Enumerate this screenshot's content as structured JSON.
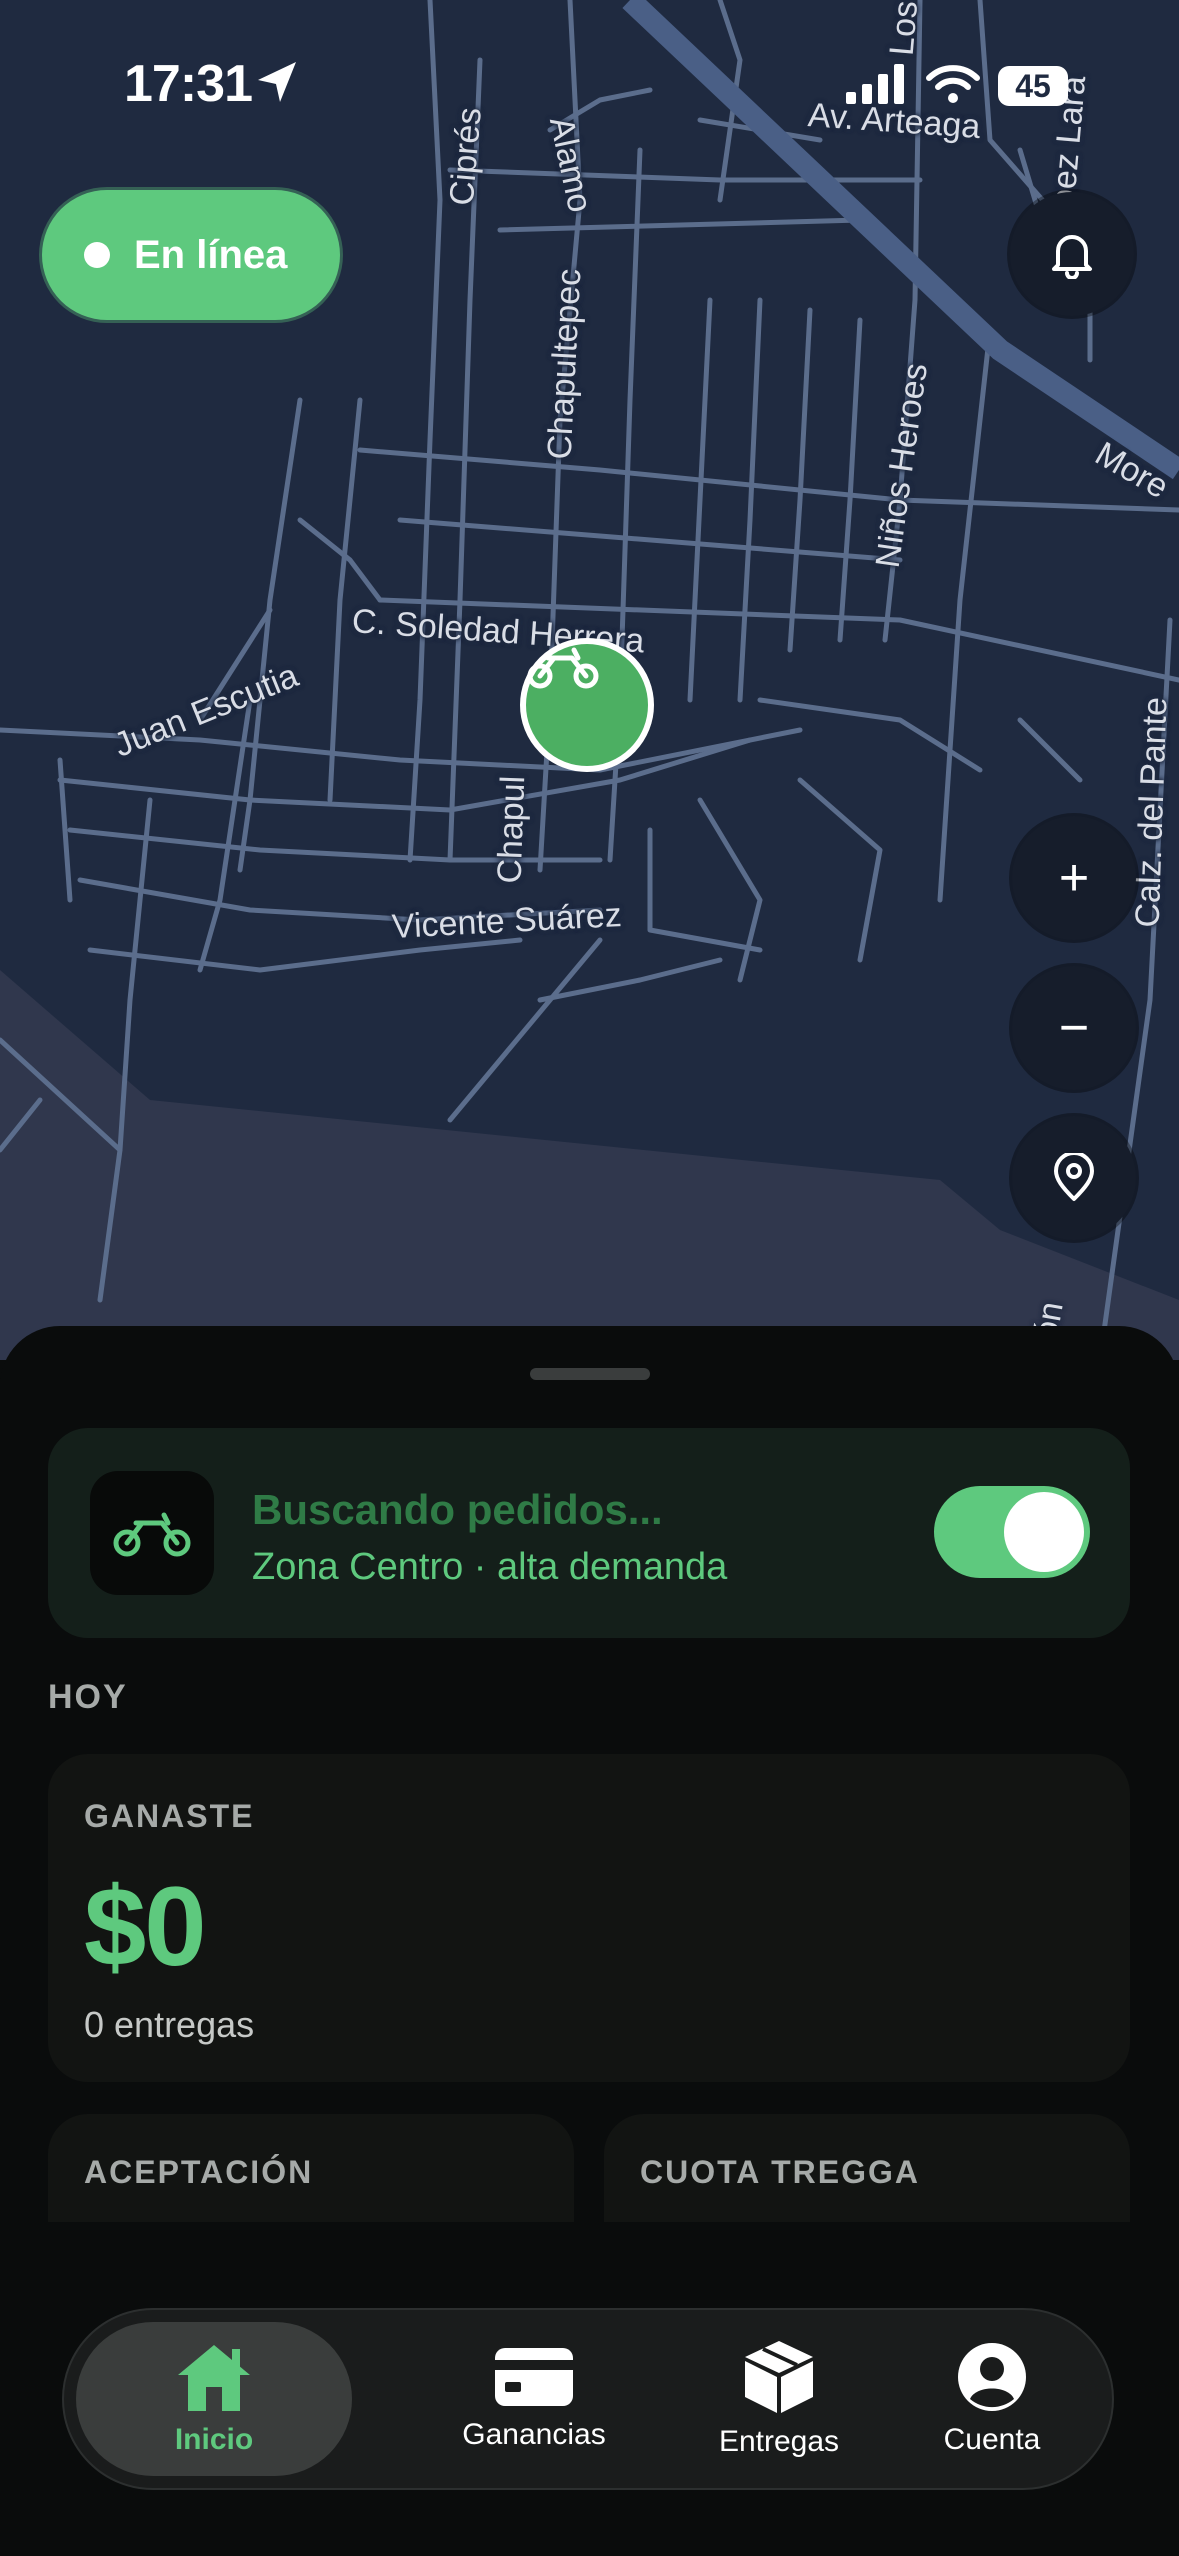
{
  "status_bar": {
    "time": "17:31",
    "battery": "45"
  },
  "map": {
    "streets": [
      "Ciprés",
      "Alamo",
      "Chapultepec",
      "Los",
      "Av. Arteaga",
      "López Lara",
      "More",
      "Niños Heroes",
      "C. Soledad Herrera",
      "Juan Escutia",
      "Chapul",
      "Vicente Suárez",
      "Calz. del Pante",
      "ón"
    ]
  },
  "online_pill": {
    "label": "En línea"
  },
  "map_buttons": {
    "zoom_in": "+",
    "zoom_out": "−"
  },
  "sheet": {
    "search": {
      "title": "Buscando pedidos...",
      "subtitle": "Zona Centro · alta demanda",
      "toggle_on": true
    },
    "today_label": "HOY",
    "earnings": {
      "label": "GANASTE",
      "amount": "$0",
      "deliveries": "0 entregas"
    },
    "acceptance_label": "ACEPTACIÓN",
    "quota_label": "CUOTA TREGGA"
  },
  "tabbar": {
    "tabs": [
      {
        "label": "Inicio",
        "icon": "home-icon",
        "active": true
      },
      {
        "label": "Ganancias",
        "icon": "card-icon",
        "active": false
      },
      {
        "label": "Entregas",
        "icon": "box-icon",
        "active": false
      },
      {
        "label": "Cuenta",
        "icon": "user-icon",
        "active": false
      }
    ]
  },
  "colors": {
    "accent": "#5ec97e",
    "map_bg": "#1f2a40",
    "sheet_bg": "#0a0c0c",
    "card_bg": "#121412"
  }
}
